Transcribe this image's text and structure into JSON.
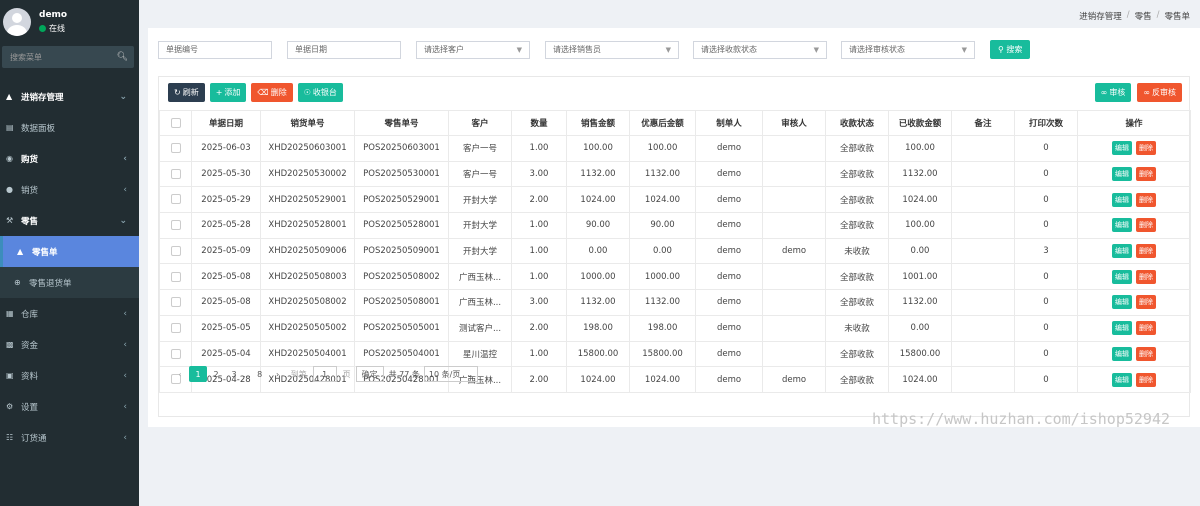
{
  "user": {
    "name": "demo",
    "status": "在线"
  },
  "sidebar": {
    "search_placeholder": "搜索菜单",
    "items": [
      {
        "label": "进销存管理",
        "icon": "graduation-cap-icon"
      },
      {
        "label": "数据面板",
        "icon": "dashboard-icon"
      },
      {
        "label": "购货",
        "icon": "car-icon"
      },
      {
        "label": "销货",
        "icon": "apple-icon"
      },
      {
        "label": "零售",
        "icon": "wrench-icon"
      },
      {
        "label": "零售单",
        "icon": "area-chart-icon"
      },
      {
        "label": "零售退货单",
        "icon": "plus-circle-icon"
      },
      {
        "label": "仓库",
        "icon": "building-icon"
      },
      {
        "label": "资金",
        "icon": "money-icon"
      },
      {
        "label": "资料",
        "icon": "cubes-icon"
      },
      {
        "label": "设置",
        "icon": "cogs-icon"
      },
      {
        "label": "订货通",
        "icon": "sitemap-icon"
      }
    ]
  },
  "breadcrumb": [
    "进销存管理",
    "零售",
    "零售单"
  ],
  "filters": {
    "doc_no": "单据编号",
    "doc_date": "单据日期",
    "customer": "请选择客户",
    "salesperson": "请选择销售员",
    "payment_status": "请选择收款状态",
    "audit_status": "请选择审核状态",
    "search_label": "搜索"
  },
  "toolbar": {
    "refresh": "刷新",
    "add": "添加",
    "delete": "删除",
    "cashier": "收银台",
    "audit": "审核",
    "unaudit": "反审核"
  },
  "table": {
    "headers": [
      "单据日期",
      "销货单号",
      "零售单号",
      "客户",
      "数量",
      "销售金额",
      "优惠后金额",
      "制单人",
      "审核人",
      "收款状态",
      "已收款金额",
      "备注",
      "打印次数",
      "操作"
    ],
    "edit_label": "编辑",
    "delete_label": "删除",
    "rows": [
      [
        "2025-06-03",
        "XHD20250603001",
        "POS20250603001",
        "客户一号",
        "1.00",
        "100.00",
        "100.00",
        "demo",
        "",
        "全部收款",
        "100.00",
        "",
        "0"
      ],
      [
        "2025-05-30",
        "XHD20250530002",
        "POS20250530001",
        "客户一号",
        "3.00",
        "1132.00",
        "1132.00",
        "demo",
        "",
        "全部收款",
        "1132.00",
        "",
        "0"
      ],
      [
        "2025-05-29",
        "XHD20250529001",
        "POS20250529001",
        "开封大学",
        "2.00",
        "1024.00",
        "1024.00",
        "demo",
        "",
        "全部收款",
        "1024.00",
        "",
        "0"
      ],
      [
        "2025-05-28",
        "XHD20250528001",
        "POS20250528001",
        "开封大学",
        "1.00",
        "90.00",
        "90.00",
        "demo",
        "",
        "全部收款",
        "100.00",
        "",
        "0"
      ],
      [
        "2025-05-09",
        "XHD20250509006",
        "POS20250509001",
        "开封大学",
        "1.00",
        "0.00",
        "0.00",
        "demo",
        "demo",
        "未收款",
        "0.00",
        "",
        "3"
      ],
      [
        "2025-05-08",
        "XHD20250508003",
        "POS20250508002",
        "广西玉林...",
        "1.00",
        "1000.00",
        "1000.00",
        "demo",
        "",
        "全部收款",
        "1001.00",
        "",
        "0"
      ],
      [
        "2025-05-08",
        "XHD20250508002",
        "POS20250508001",
        "广西玉林...",
        "3.00",
        "1132.00",
        "1132.00",
        "demo",
        "",
        "全部收款",
        "1132.00",
        "",
        "0"
      ],
      [
        "2025-05-05",
        "XHD20250505002",
        "POS20250505001",
        "测试客户...",
        "2.00",
        "198.00",
        "198.00",
        "demo",
        "",
        "未收款",
        "0.00",
        "",
        "0"
      ],
      [
        "2025-05-04",
        "XHD20250504001",
        "POS20250504001",
        "星川温控",
        "1.00",
        "15800.00",
        "15800.00",
        "demo",
        "",
        "全部收款",
        "15800.00",
        "",
        "0"
      ],
      [
        "2025-04-28",
        "XHD20250428001",
        "POS20250428001",
        "广西玉林...",
        "2.00",
        "1024.00",
        "1024.00",
        "demo",
        "demo",
        "全部收款",
        "1024.00",
        "",
        "0"
      ]
    ]
  },
  "pager": {
    "prev": "‹",
    "pages": [
      "1",
      "2",
      "3"
    ],
    "ellipsis": "...",
    "last": "8",
    "next": "›",
    "goto_label": "到第",
    "goto_value": "1",
    "page_unit": "页",
    "confirm": "确定",
    "total": "共 77 条",
    "page_size": "10 条/页"
  },
  "watermark": "https://www.huzhan.com/ishop52942"
}
